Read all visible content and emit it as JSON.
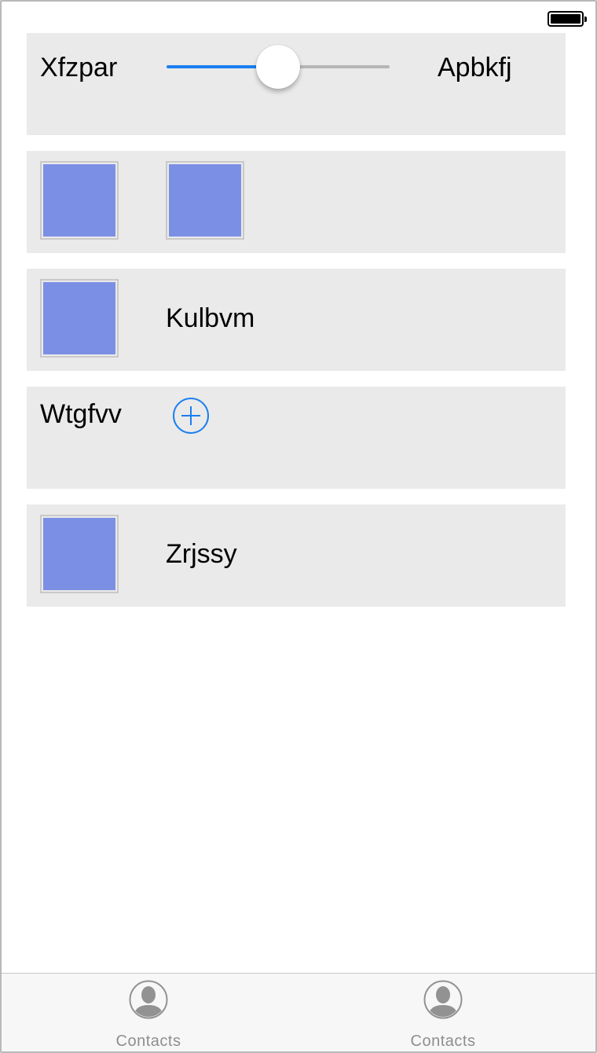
{
  "slider_row": {
    "min_label": "Xfzpar",
    "max_label": "Apbkfj",
    "value": 0.5,
    "accent": "#1a7ff0",
    "track_color": "#b6b6b6"
  },
  "image_row": {
    "thumbnail_color": "#7b8fe5",
    "thumbnail_count": 2
  },
  "image_label_row_1": {
    "label": "Kulbvm"
  },
  "add_row": {
    "label": "Wtgfvv",
    "icon": "plus-circle-icon"
  },
  "image_label_row_2": {
    "label": "Zrjssy"
  },
  "tab_bar": {
    "items": [
      {
        "label": "Contacts",
        "icon": "person-icon"
      },
      {
        "label": "Contacts",
        "icon": "person-icon"
      }
    ]
  }
}
